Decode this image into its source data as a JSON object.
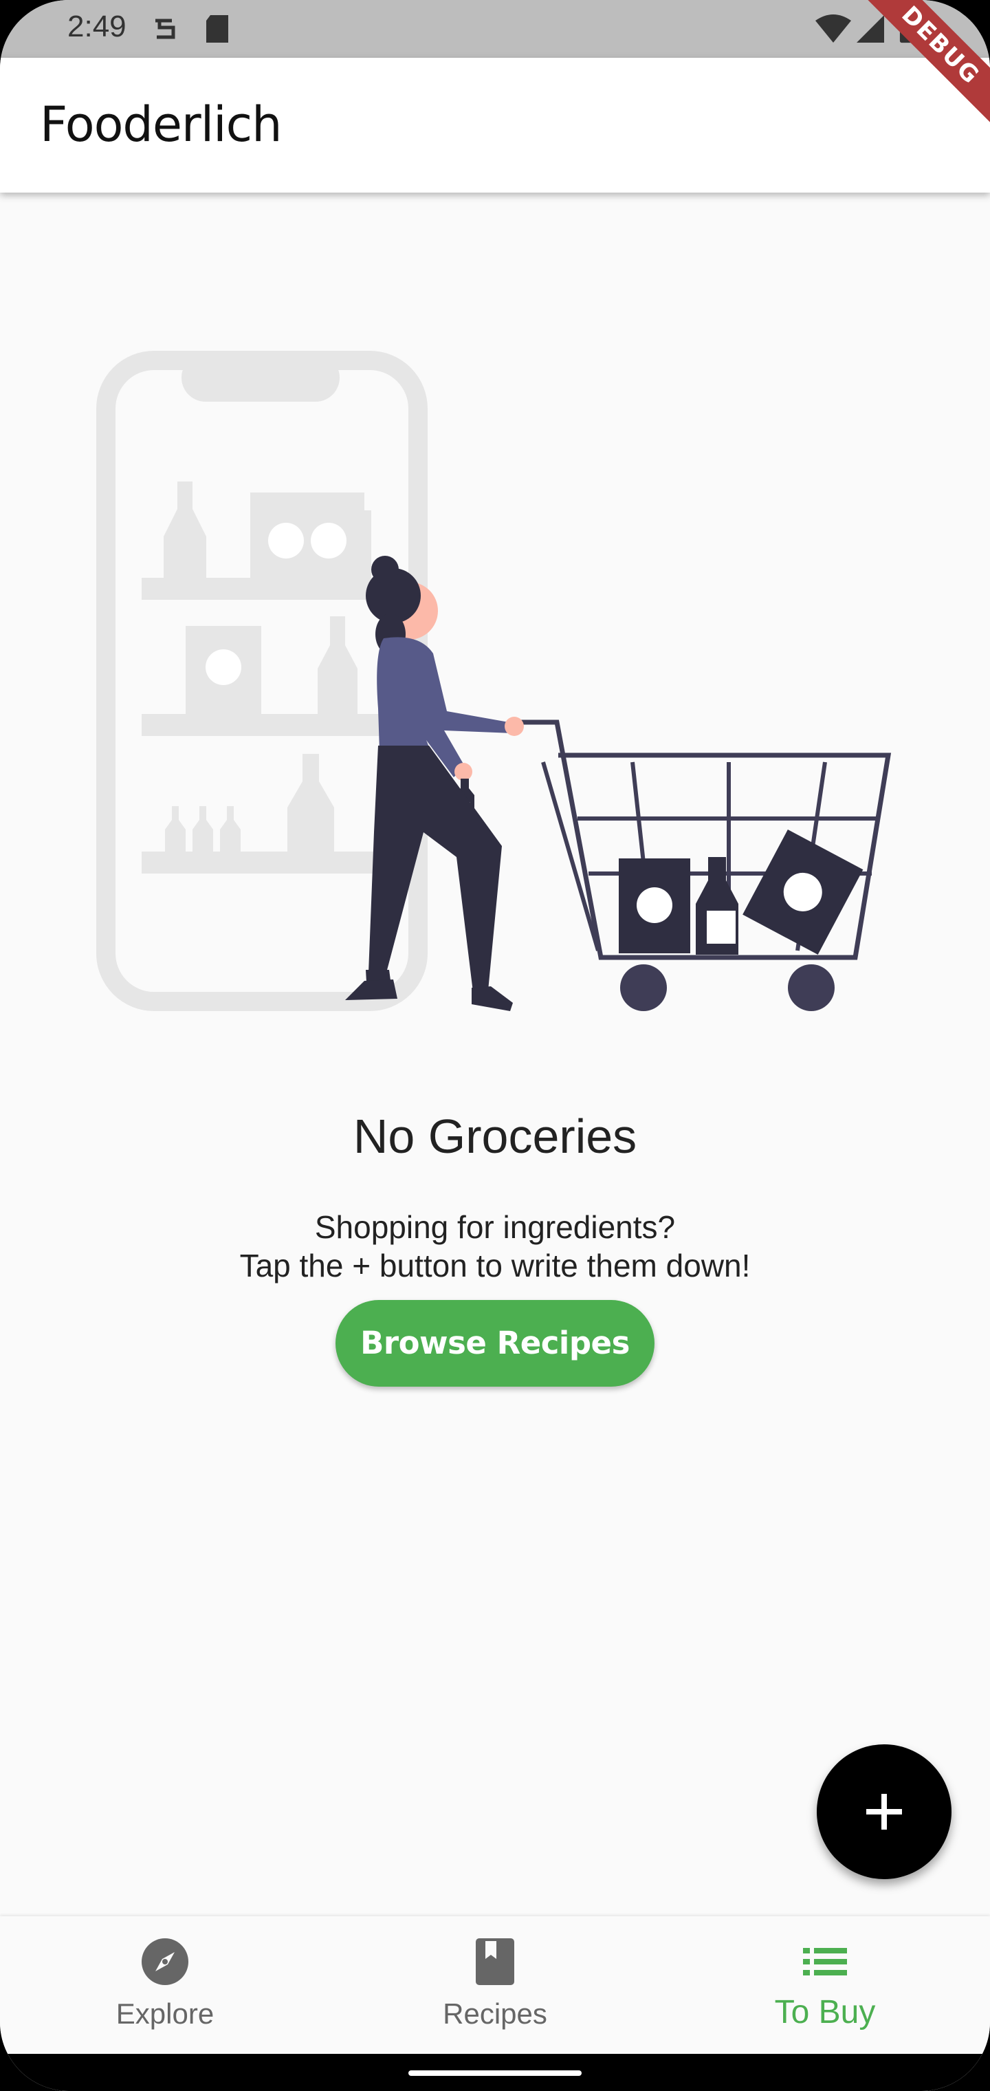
{
  "status_bar": {
    "time": "2:49"
  },
  "app_bar": {
    "title": "Fooderlich",
    "debug_label": "DEBUG"
  },
  "empty_state": {
    "title": "No Groceries",
    "message_line1": "Shopping for ingredients?",
    "message_line2": "Tap the + button to write them down!",
    "button_label": "Browse Recipes"
  },
  "fab": {
    "icon": "plus-icon"
  },
  "bottom_nav": {
    "items": [
      {
        "label": "Explore",
        "icon": "compass-icon",
        "active": false
      },
      {
        "label": "Recipes",
        "icon": "book-icon",
        "active": false
      },
      {
        "label": "To Buy",
        "icon": "list-icon",
        "active": true
      }
    ]
  },
  "colors": {
    "accent": "#4caf50",
    "illustration_dark": "#2f2e41",
    "illustration_purple": "#575a89",
    "illustration_gray": "#e6e6e6",
    "fab": "#000000"
  }
}
